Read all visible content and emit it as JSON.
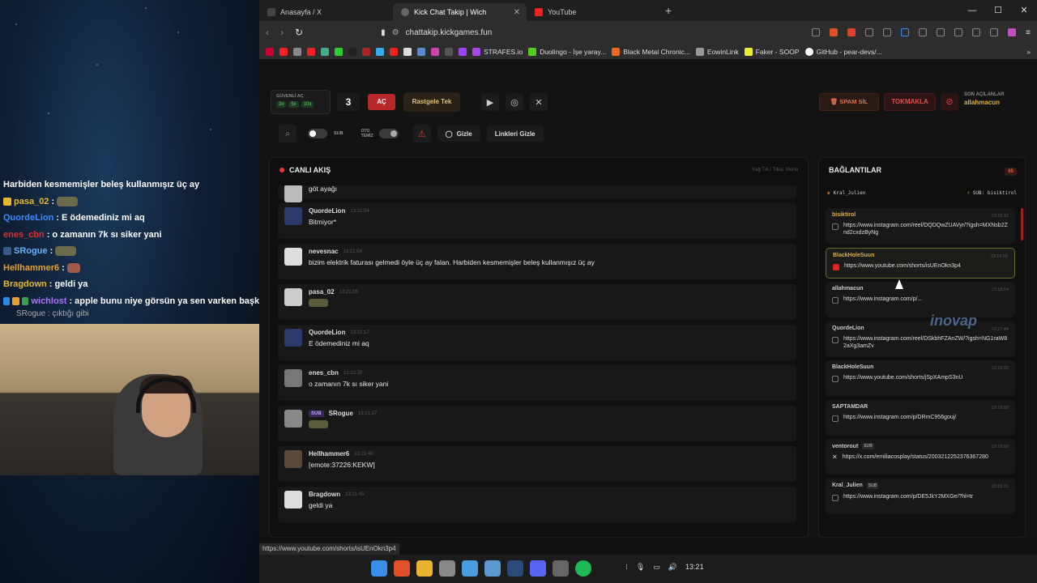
{
  "stream_chat": [
    {
      "user": "",
      "text": "Harbiden kesmemişler beleş kullanmışız üç ay",
      "color": "#ffffff",
      "emote": false
    },
    {
      "user": "pasa_02",
      "text": "",
      "color": "#e8b730",
      "emote": true
    },
    {
      "user": "QuordeLion",
      "text": "E ödemediniz mi aq",
      "color": "#3a8cff",
      "emote": false
    },
    {
      "user": "enes_cbn",
      "text": "o zamanın 7k sı siker yani",
      "color": "#e03030",
      "emote": false
    },
    {
      "user": "SRogue",
      "text": "",
      "color": "#6ab0ff",
      "emote": true
    },
    {
      "user": "Hellhammer6",
      "text": "",
      "color": "#e8a030",
      "emote": true
    },
    {
      "user": "Bragdown",
      "text": "geldi ya",
      "color": "#e8b730",
      "emote": false
    },
    {
      "user": "wichlost",
      "text": "apple bunu niye görsün ya sen varken başkan",
      "color": "#b070ff",
      "emote": false
    }
  ],
  "stream_reply": "SRogue : çıktığı gibi",
  "tabs": [
    {
      "label": "Anasayfa / X",
      "icon": "x-icon",
      "active": false
    },
    {
      "label": "Kick Chat Takip | Wich",
      "icon": "kick-icon",
      "active": true
    },
    {
      "label": "YouTube",
      "icon": "youtube-icon",
      "active": false
    }
  ],
  "address": {
    "url": "chattakip.kickgames.fun"
  },
  "bookmarks": [
    "STRAFES.io",
    "Duolingo - İşe yaray...",
    "Black Metal Chronic...",
    "EowinLink",
    "Faker - SOOP",
    "GitHub - pear-devs/..."
  ],
  "controls": {
    "guvenli_label": "GÜVENLİ AÇ",
    "multipliers": [
      "3x",
      "5x",
      "10x"
    ],
    "count": "3",
    "ac_label": "AÇ",
    "rastgele_label": "Rastgele Tek",
    "spam_label": "SPAM SİL",
    "tokmak_label": "TOKMAKLA",
    "son_label": "SON AÇILANLAR",
    "son_user": "allahmacun",
    "sub_label": "SUB",
    "oto_label": "OTO TEMİZ",
    "gizle_label": "Gizle",
    "linkleri_gizle_label": "Linkleri Gizle"
  },
  "feed": {
    "title": "CANLI AKIŞ",
    "hint": "Sağ Tık / Tıkla: Menü",
    "first": {
      "user": "",
      "text": "göt ayağı"
    },
    "messages": [
      {
        "user": "QuordeLion",
        "time": "13:21:04",
        "text": "Bitmiyor*",
        "sub": false,
        "emote": false
      },
      {
        "user": "nevesnac",
        "time": "13:21:04",
        "text": "bizim elektrik faturası gelmedi öyle üç ay falan. Harbiden kesmemişler beleş kullanmışız üç ay",
        "sub": false,
        "emote": false
      },
      {
        "user": "pasa_02",
        "time": "13:21:05",
        "text": "",
        "sub": false,
        "emote": true
      },
      {
        "user": "QuordeLion",
        "time": "13:21:17",
        "text": "E ödemediniz mi aq",
        "sub": false,
        "emote": false
      },
      {
        "user": "enes_cbn",
        "time": "13:21:29",
        "text": "o zamanın 7k sı siker yani",
        "sub": false,
        "emote": false
      },
      {
        "user": "SRogue",
        "time": "13:21:37",
        "text": "",
        "sub": true,
        "sub_label": "SUB",
        "emote": true
      },
      {
        "user": "Hellhammer6",
        "time": "13:21:40",
        "text": "[emote:37226:KEKW]",
        "sub": false,
        "emote": false
      },
      {
        "user": "Bragdown",
        "time": "13:21:45",
        "text": "geldi ya",
        "sub": false,
        "emote": false
      }
    ]
  },
  "links": {
    "title": "BAĞLANTILAR",
    "count": "65",
    "pinned_left": "Kral_Julien",
    "pinned_right_label": "SUB:",
    "pinned_right_user": "bisiktirol",
    "items": [
      {
        "user": "bisiktirol",
        "time": "13:19:12",
        "url": "https://www.instagram.com/reel/DQDQwZUAVyr/?igsh=MXNsb2Znd2cxdzByNg",
        "platform": "instagram",
        "sub": false,
        "active": false
      },
      {
        "user": "BlackHoleSuun",
        "time": "13:19:03",
        "url": "https://www.youtube.com/shorts/isUEnOkn3p4",
        "platform": "youtube",
        "sub": false,
        "active": true
      },
      {
        "user": "allahmacun",
        "time": "13:18:54",
        "url": "https://www.instagram.com/p/...",
        "platform": "instagram",
        "sub": false,
        "active": false
      },
      {
        "user": "QuordeLion",
        "time": "13:17:44",
        "url": "https://www.instagram.com/reel/DSkbhFZAnZW/?igsh=NG1raW82aXg3amZv",
        "platform": "instagram",
        "sub": false,
        "active": false
      },
      {
        "user": "BlackHoleSuun",
        "time": "13:16:22",
        "url": "https://www.youtube.com/shorts/jSpXAmpS3nU",
        "platform": "youtube",
        "sub": false,
        "active": false
      },
      {
        "user": "SAPTAMDAR",
        "time": "13:15:58",
        "url": "https://www.instagram.com/p/DRmC956gouj/",
        "platform": "instagram",
        "sub": false,
        "active": false
      },
      {
        "user": "ventorout",
        "time": "13:15:50",
        "url": "https://x.com/emiliacosplay/status/2003212252376367280",
        "platform": "x",
        "sub": true,
        "active": false
      },
      {
        "user": "Kral_Julien",
        "time": "13:15:31",
        "url": "https://www.instagram.com/p/DE5JkY2MXGe/?hl=tr",
        "platform": "instagram",
        "sub": true,
        "active": false
      }
    ]
  },
  "status_url": "https://www.youtube.com/shorts/isUEnOkn3p4",
  "clock": "13:21",
  "watermark": "inovap"
}
